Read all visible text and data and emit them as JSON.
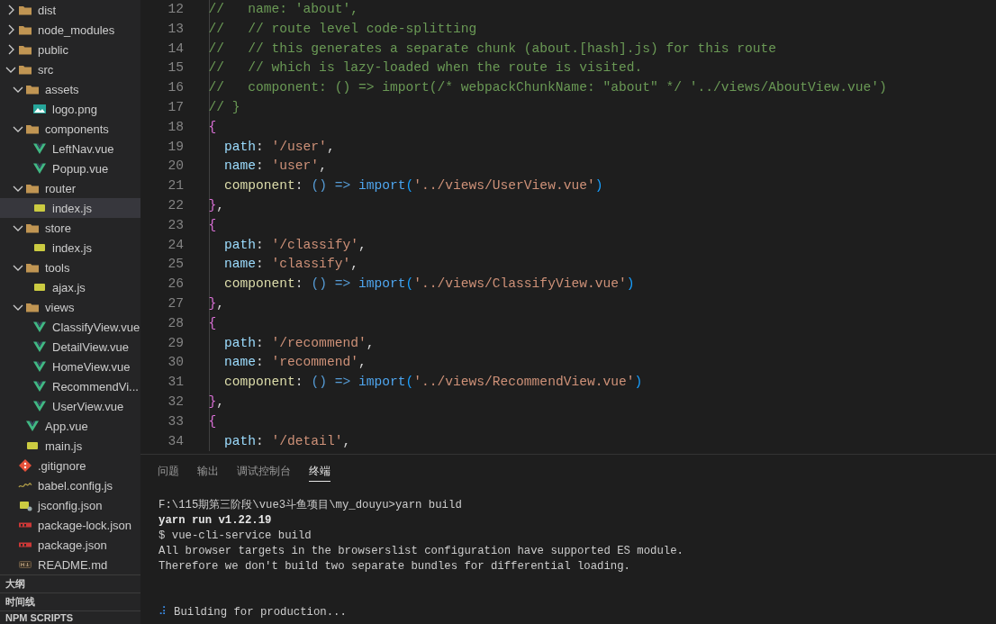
{
  "explorer": {
    "items": [
      {
        "kind": "folder",
        "label": "dist",
        "expanded": false,
        "selected": false
      },
      {
        "kind": "folder",
        "label": "node_modules",
        "expanded": false,
        "selected": false
      },
      {
        "kind": "folder",
        "label": "public",
        "expanded": false,
        "selected": false
      },
      {
        "kind": "folder",
        "label": "src",
        "expanded": true,
        "selected": false,
        "children": [
          {
            "kind": "folder",
            "label": "assets",
            "expanded": true,
            "selected": false,
            "children": [
              {
                "kind": "image",
                "label": "logo.png",
                "selected": false
              }
            ]
          },
          {
            "kind": "folder",
            "label": "components",
            "expanded": true,
            "selected": false,
            "children": [
              {
                "kind": "vue",
                "label": "LeftNav.vue",
                "selected": false
              },
              {
                "kind": "vue",
                "label": "Popup.vue",
                "selected": false
              }
            ]
          },
          {
            "kind": "folder",
            "label": "router",
            "expanded": true,
            "selected": false,
            "children": [
              {
                "kind": "js",
                "label": "index.js",
                "selected": true
              }
            ]
          },
          {
            "kind": "folder",
            "label": "store",
            "expanded": true,
            "selected": false,
            "children": [
              {
                "kind": "js",
                "label": "index.js",
                "selected": false
              }
            ]
          },
          {
            "kind": "folder",
            "label": "tools",
            "expanded": true,
            "selected": false,
            "children": [
              {
                "kind": "js",
                "label": "ajax.js",
                "selected": false
              }
            ]
          },
          {
            "kind": "folder",
            "label": "views",
            "expanded": true,
            "selected": false,
            "children": [
              {
                "kind": "vue",
                "label": "ClassifyView.vue",
                "selected": false
              },
              {
                "kind": "vue",
                "label": "DetailView.vue",
                "selected": false
              },
              {
                "kind": "vue",
                "label": "HomeView.vue",
                "selected": false
              },
              {
                "kind": "vue",
                "label": "RecommendVi...",
                "selected": false
              },
              {
                "kind": "vue",
                "label": "UserView.vue",
                "selected": false
              }
            ]
          },
          {
            "kind": "vue",
            "label": "App.vue",
            "selected": false
          },
          {
            "kind": "js",
            "label": "main.js",
            "selected": false
          }
        ]
      },
      {
        "kind": "git",
        "label": ".gitignore",
        "selected": false
      },
      {
        "kind": "babel",
        "label": "babel.config.js",
        "selected": false
      },
      {
        "kind": "jsconfig",
        "label": "jsconfig.json",
        "selected": false
      },
      {
        "kind": "npm",
        "label": "package-lock.json",
        "selected": false
      },
      {
        "kind": "npm",
        "label": "package.json",
        "selected": false
      },
      {
        "kind": "markdown",
        "label": "README.md",
        "selected": false
      }
    ]
  },
  "side_panels": [
    "大纲",
    "时间线",
    "NPM SCRIPTS"
  ],
  "editor": {
    "lines": [
      {
        "number": "12",
        "tokens": [
          {
            "kind": "comment",
            "text": "  //   name: 'about',"
          }
        ]
      },
      {
        "number": "13",
        "tokens": [
          {
            "kind": "comment",
            "text": "  //   // route level code-splitting"
          }
        ]
      },
      {
        "number": "14",
        "tokens": [
          {
            "kind": "comment",
            "text": "  //   // this generates a separate chunk (about.[hash].js) for this route"
          }
        ]
      },
      {
        "number": "15",
        "tokens": [
          {
            "kind": "comment",
            "text": "  //   // which is lazy-loaded when the route is visited."
          }
        ]
      },
      {
        "number": "16",
        "tokens": [
          {
            "kind": "comment",
            "text": "  //   component: () => import(/* webpackChunkName: \"about\" */ '../views/AboutView.vue')"
          }
        ]
      },
      {
        "number": "17",
        "tokens": [
          {
            "kind": "comment",
            "text": "  // }"
          }
        ]
      },
      {
        "number": "18",
        "tokens": [
          {
            "kind": "brace",
            "text": "  {"
          }
        ]
      },
      {
        "number": "19",
        "tokens": [
          {
            "kind": "prop",
            "text": "    path"
          },
          {
            "kind": "punct",
            "text": ": "
          },
          {
            "kind": "string",
            "text": "'/user'"
          },
          {
            "kind": "punct",
            "text": ","
          }
        ]
      },
      {
        "number": "20",
        "tokens": [
          {
            "kind": "prop",
            "text": "    name"
          },
          {
            "kind": "punct",
            "text": ": "
          },
          {
            "kind": "string",
            "text": "'user'"
          },
          {
            "kind": "punct",
            "text": ","
          }
        ]
      },
      {
        "number": "21",
        "tokens": [
          {
            "kind": "method",
            "text": "    component"
          },
          {
            "kind": "punct",
            "text": ": "
          },
          {
            "kind": "arrow",
            "text": "() =>"
          },
          {
            "kind": "call",
            "text": " import"
          },
          {
            "kind": "paren",
            "text": "("
          },
          {
            "kind": "string",
            "text": "'../views/UserView.vue'"
          },
          {
            "kind": "paren",
            "text": ")"
          }
        ]
      },
      {
        "number": "22",
        "tokens": [
          {
            "kind": "brace",
            "text": "  }"
          },
          {
            "kind": "punct",
            "text": ","
          }
        ]
      },
      {
        "number": "23",
        "tokens": [
          {
            "kind": "brace",
            "text": "  {"
          }
        ]
      },
      {
        "number": "24",
        "tokens": [
          {
            "kind": "prop",
            "text": "    path"
          },
          {
            "kind": "punct",
            "text": ": "
          },
          {
            "kind": "string",
            "text": "'/classify'"
          },
          {
            "kind": "punct",
            "text": ","
          }
        ]
      },
      {
        "number": "25",
        "tokens": [
          {
            "kind": "prop",
            "text": "    name"
          },
          {
            "kind": "punct",
            "text": ": "
          },
          {
            "kind": "string",
            "text": "'classify'"
          },
          {
            "kind": "punct",
            "text": ","
          }
        ]
      },
      {
        "number": "26",
        "tokens": [
          {
            "kind": "method",
            "text": "    component"
          },
          {
            "kind": "punct",
            "text": ": "
          },
          {
            "kind": "arrow",
            "text": "() =>"
          },
          {
            "kind": "call",
            "text": " import"
          },
          {
            "kind": "paren",
            "text": "("
          },
          {
            "kind": "string",
            "text": "'../views/ClassifyView.vue'"
          },
          {
            "kind": "paren",
            "text": ")"
          }
        ]
      },
      {
        "number": "27",
        "tokens": [
          {
            "kind": "brace",
            "text": "  }"
          },
          {
            "kind": "punct",
            "text": ","
          }
        ]
      },
      {
        "number": "28",
        "tokens": [
          {
            "kind": "brace",
            "text": "  {"
          }
        ]
      },
      {
        "number": "29",
        "tokens": [
          {
            "kind": "prop",
            "text": "    path"
          },
          {
            "kind": "punct",
            "text": ": "
          },
          {
            "kind": "string",
            "text": "'/recommend'"
          },
          {
            "kind": "punct",
            "text": ","
          }
        ]
      },
      {
        "number": "30",
        "tokens": [
          {
            "kind": "prop",
            "text": "    name"
          },
          {
            "kind": "punct",
            "text": ": "
          },
          {
            "kind": "string",
            "text": "'recommend'"
          },
          {
            "kind": "punct",
            "text": ","
          }
        ]
      },
      {
        "number": "31",
        "tokens": [
          {
            "kind": "method",
            "text": "    component"
          },
          {
            "kind": "punct",
            "text": ": "
          },
          {
            "kind": "arrow",
            "text": "() =>"
          },
          {
            "kind": "call",
            "text": " import"
          },
          {
            "kind": "paren",
            "text": "("
          },
          {
            "kind": "string",
            "text": "'../views/RecommendView.vue'"
          },
          {
            "kind": "paren",
            "text": ")"
          }
        ]
      },
      {
        "number": "32",
        "tokens": [
          {
            "kind": "brace",
            "text": "  }"
          },
          {
            "kind": "punct",
            "text": ","
          }
        ]
      },
      {
        "number": "33",
        "tokens": [
          {
            "kind": "brace",
            "text": "  {"
          }
        ]
      },
      {
        "number": "34",
        "tokens": [
          {
            "kind": "prop",
            "text": "    path"
          },
          {
            "kind": "punct",
            "text": ": "
          },
          {
            "kind": "string",
            "text": "'/detail'"
          },
          {
            "kind": "punct",
            "text": ","
          }
        ]
      }
    ]
  },
  "panel": {
    "tabs": [
      {
        "label": "问题",
        "selected": false
      },
      {
        "label": "输出",
        "selected": false
      },
      {
        "label": "调试控制台",
        "selected": false
      },
      {
        "label": "终端",
        "selected": true
      }
    ],
    "terminal": [
      {
        "kind": "plain",
        "text": "F:\\115期第三阶段\\vue3斗鱼项目\\my_douyu>yarn build"
      },
      {
        "kind": "bold",
        "text": "yarn run v1.22.19"
      },
      {
        "kind": "plain",
        "text": "$ vue-cli-service build"
      },
      {
        "kind": "plain",
        "text": "All browser targets in the browserslist configuration have supported ES module."
      },
      {
        "kind": "plain",
        "text": "Therefore we don't build two separate bundles for differential loading."
      },
      {
        "kind": "progress",
        "spinner": "⠼",
        "text": "Building for production..."
      }
    ]
  }
}
